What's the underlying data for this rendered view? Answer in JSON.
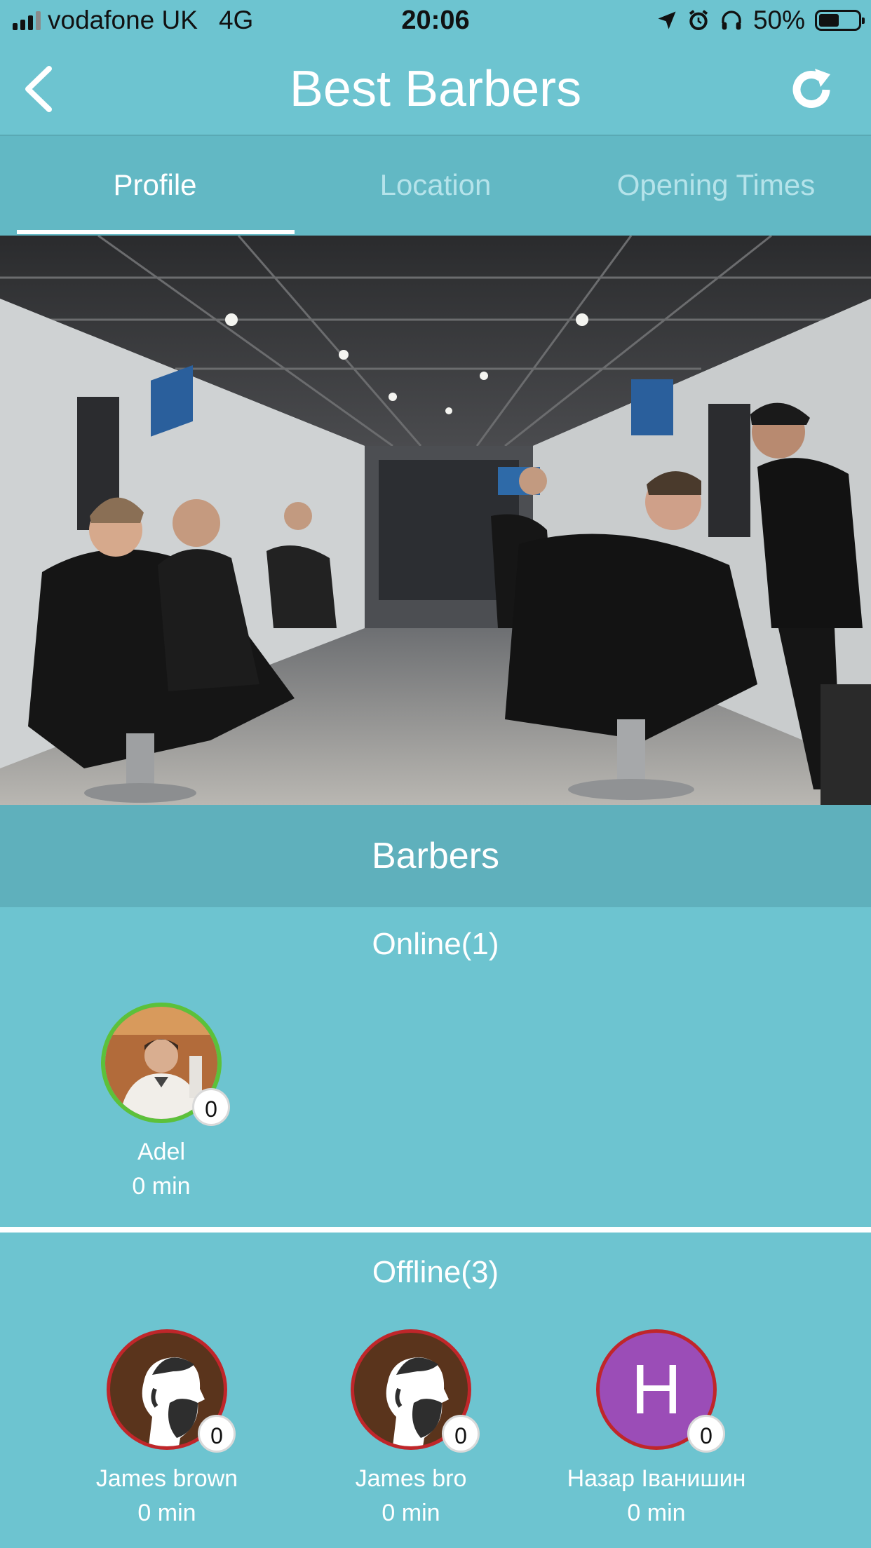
{
  "status": {
    "carrier": "vodafone UK",
    "network": "4G",
    "time": "20:06",
    "battery": "50%"
  },
  "nav": {
    "title": "Best Barbers"
  },
  "tabs": [
    {
      "label": "Profile",
      "active": true
    },
    {
      "label": "Location",
      "active": false
    },
    {
      "label": "Opening Times",
      "active": false
    }
  ],
  "section_title": "Barbers",
  "online": {
    "title": "Online(1)",
    "barbers": [
      {
        "name": "Adel",
        "wait": "0 min",
        "queue": "0"
      }
    ]
  },
  "offline": {
    "title": "Offline(3)",
    "barbers": [
      {
        "name": "James brown",
        "wait": "0 min",
        "queue": "0"
      },
      {
        "name": "James bro",
        "wait": "0 min",
        "queue": "0"
      },
      {
        "name": "Назар Іванишин",
        "wait": "0 min",
        "queue": "0",
        "initial": "H"
      }
    ]
  },
  "colors": {
    "background": "#6dc4d0",
    "online_ring": "#5cc13a",
    "offline_ring": "#c0262a",
    "initial_avatar": "#9b4db7"
  }
}
